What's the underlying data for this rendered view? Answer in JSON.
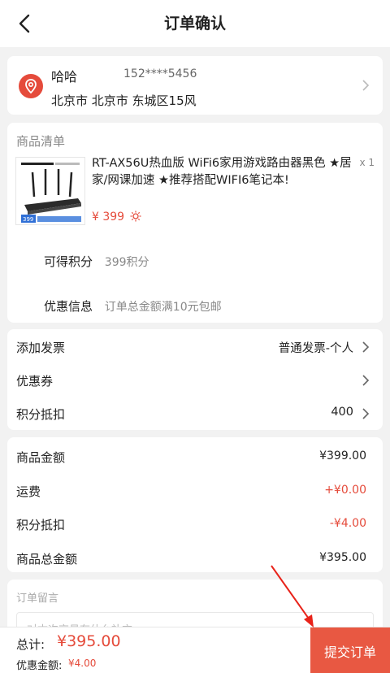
{
  "header": {
    "title": "订单确认",
    "back_icon": "chevron-left-icon"
  },
  "address": {
    "name": "哈哈",
    "phone": "152****5456",
    "detail": "北京市 北京市 东城区15风",
    "icon": "location-pin-icon",
    "icon_color": "#e54b3b"
  },
  "goods": {
    "section_title": "商品清单",
    "product": {
      "name": "RT-AX56U热血版 WiFi6家用游戏路由器黑色 ★居家/网课加速 ★推荐搭配WIFI6笔记本!",
      "qty": "x 1",
      "price": "¥ 399",
      "image_icon": "router-product-image",
      "image_badge": "399"
    },
    "points_label": "可得积分",
    "points_value": "399积分",
    "promo_label": "优惠信息",
    "promo_value": "订单总金额满10元包邮"
  },
  "options": [
    {
      "label": "添加发票",
      "value": "普通发票-个人"
    },
    {
      "label": "优惠券",
      "value": ""
    },
    {
      "label": "积分抵扣",
      "value": "400"
    }
  ],
  "totals": [
    {
      "label": "商品金额",
      "value": "¥399.00",
      "accent": false
    },
    {
      "label": "运费",
      "value": "+¥0.00",
      "accent": true
    },
    {
      "label": "积分抵扣",
      "value": "-¥4.00",
      "accent": true
    },
    {
      "label": "商品总金额",
      "value": "¥395.00",
      "accent": false
    }
  ],
  "remark": {
    "title": "订单留言",
    "placeholder": "对本次交易有什么补充"
  },
  "bottom": {
    "total_label": "总计:",
    "total_amount": "¥395.00",
    "discount_label": "优惠金额:",
    "discount_amount": "¥4.00",
    "submit_label": "提交订单",
    "accent_color": "#e85842"
  }
}
